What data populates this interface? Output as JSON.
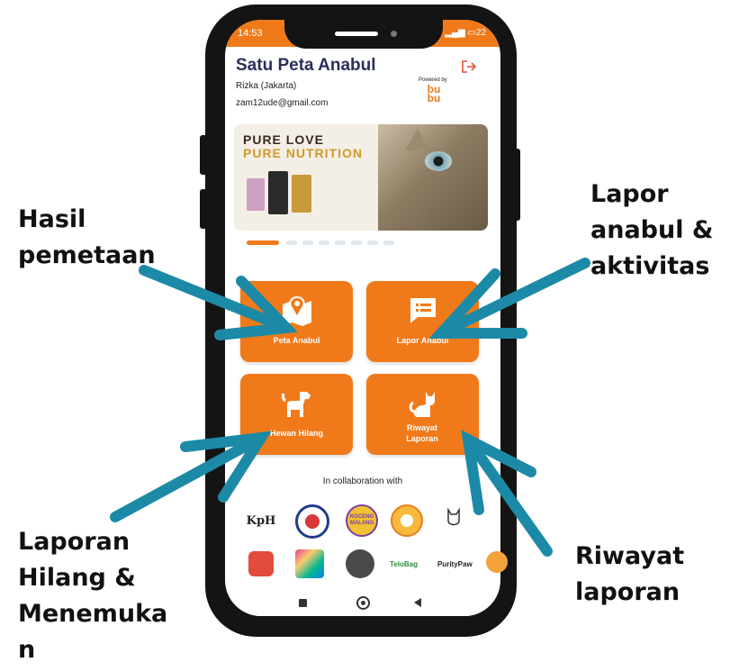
{
  "status": {
    "time": "14:53",
    "battery": "22"
  },
  "header": {
    "title": "Satu Peta Anabul",
    "user_name": "Rizka (Jakarta)",
    "user_email": "zam12ude@gmail.com",
    "powered_by": "Powered by",
    "brand_logo": "bu bu"
  },
  "banner": {
    "line1": "PURE LOVE",
    "line2": "PURE NUTRITION"
  },
  "carousel": {
    "count": 8,
    "active": 0
  },
  "menu": [
    {
      "label": "Peta Anabul",
      "icon": "map-pin-icon"
    },
    {
      "label": "Lapor Anabul",
      "icon": "chat-report-icon"
    },
    {
      "label": "Hewan Hilang",
      "icon": "dog-icon"
    },
    {
      "label": "Riwayat Laporan",
      "icon": "cat-icon"
    }
  ],
  "collab": {
    "title": "In collaboration with",
    "logos_row1": [
      "KpH",
      "",
      "KOCENG MALANG",
      "",
      ""
    ],
    "logos_row2": [
      "",
      "",
      "",
      "TeloBag",
      "PurityPaw"
    ]
  },
  "annotations": {
    "left_top": "Hasil pemetaan",
    "right_top": "Lapor anabul & aktivitas",
    "left_bottom": "Laporan Hilang & Menemukan",
    "right_bottom": "Riwayat laporan"
  },
  "colors": {
    "accent": "#f07a1a",
    "arrow": "#1c8aa6",
    "title": "#2a2f5a"
  }
}
